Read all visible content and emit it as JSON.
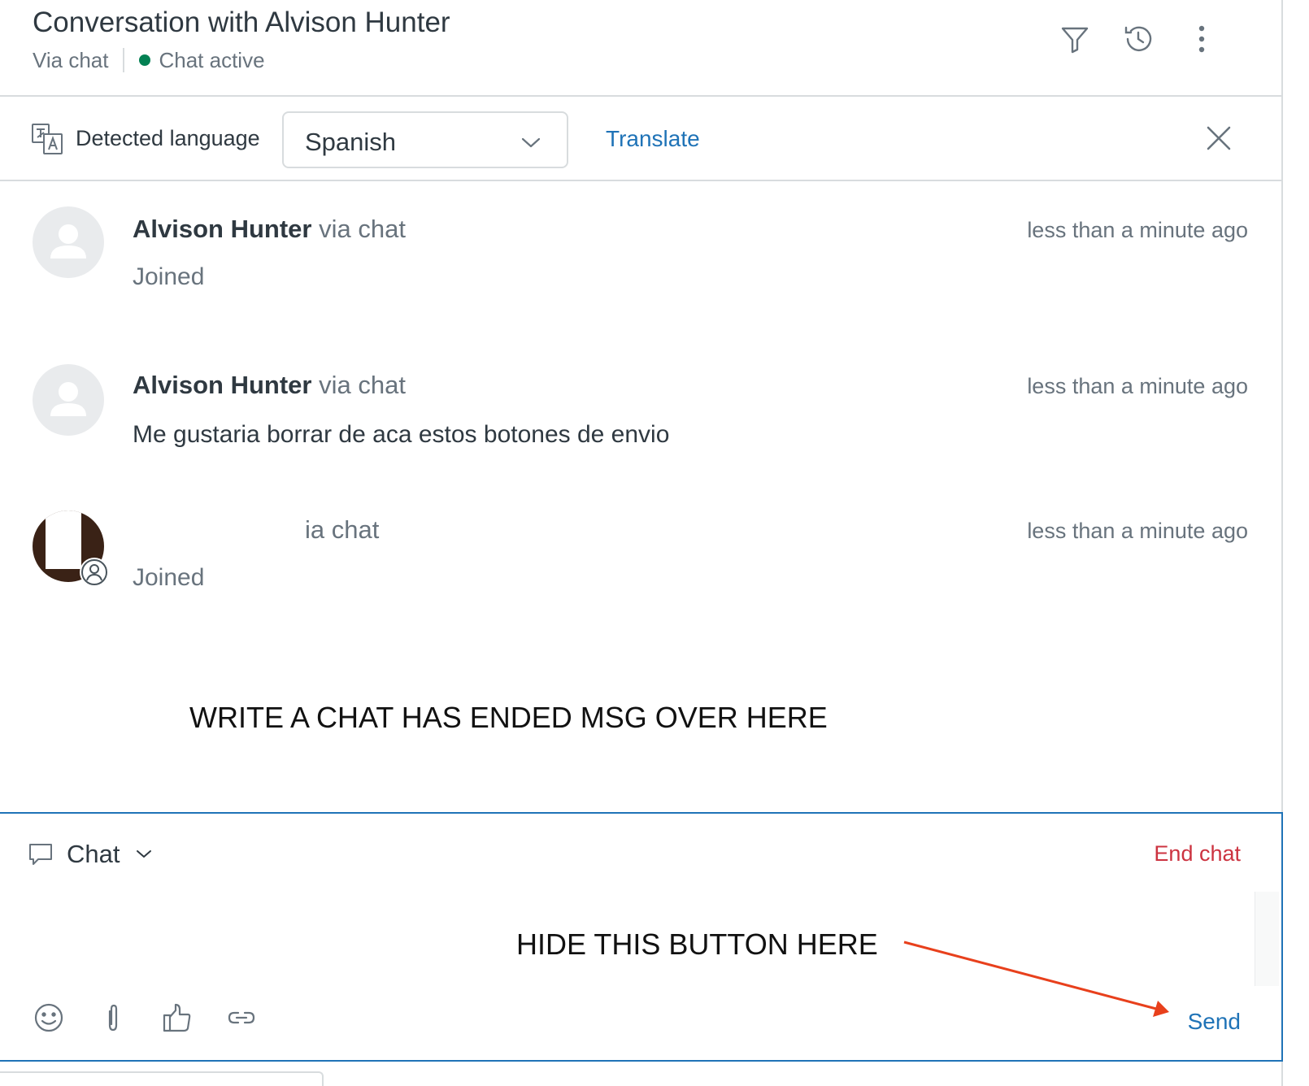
{
  "header": {
    "title": "Conversation with Alvison Hunter",
    "channel": "Via chat",
    "status": "Chat active",
    "status_color": "#038153",
    "actions": [
      {
        "name": "filter-icon"
      },
      {
        "name": "history-icon"
      },
      {
        "name": "more-options-icon"
      }
    ]
  },
  "translate_bar": {
    "icon": "translate-icon",
    "detected_label": "Detected language",
    "selected_language": "Spanish",
    "translate_label": "Translate",
    "close_icon": "close-icon"
  },
  "messages": [
    {
      "author": "Alvison Hunter",
      "via": "via chat",
      "time": "less than a minute ago",
      "body": "Joined",
      "kind": "event",
      "avatar": "user-placeholder-icon"
    },
    {
      "author": "Alvison Hunter",
      "via": "via chat",
      "time": "less than a minute ago",
      "body": "Me gustaria borrar de aca estos botones de envio",
      "kind": "text",
      "avatar": "user-placeholder-icon"
    },
    {
      "author": "",
      "via": "via chat",
      "visible_suffix": "ia chat",
      "time": "less than a minute ago",
      "body": "Joined",
      "kind": "event",
      "avatar": "agent-photo"
    }
  ],
  "annotations": {
    "ended_note": "WRITE A CHAT HAS ENDED MSG OVER HERE",
    "hide_note": "HIDE THIS BUTTON HERE",
    "arrow_color": "#e8401c"
  },
  "composer": {
    "channel_icon": "chat-bubble-icon",
    "channel_label": "Chat",
    "end_chat_label": "End chat",
    "end_chat_color": "#cc3340",
    "tools": [
      "emoji-icon",
      "attachment-icon",
      "thumbs-up-icon",
      "link-icon"
    ],
    "send_label": "Send",
    "accent": "#1f73b7"
  }
}
